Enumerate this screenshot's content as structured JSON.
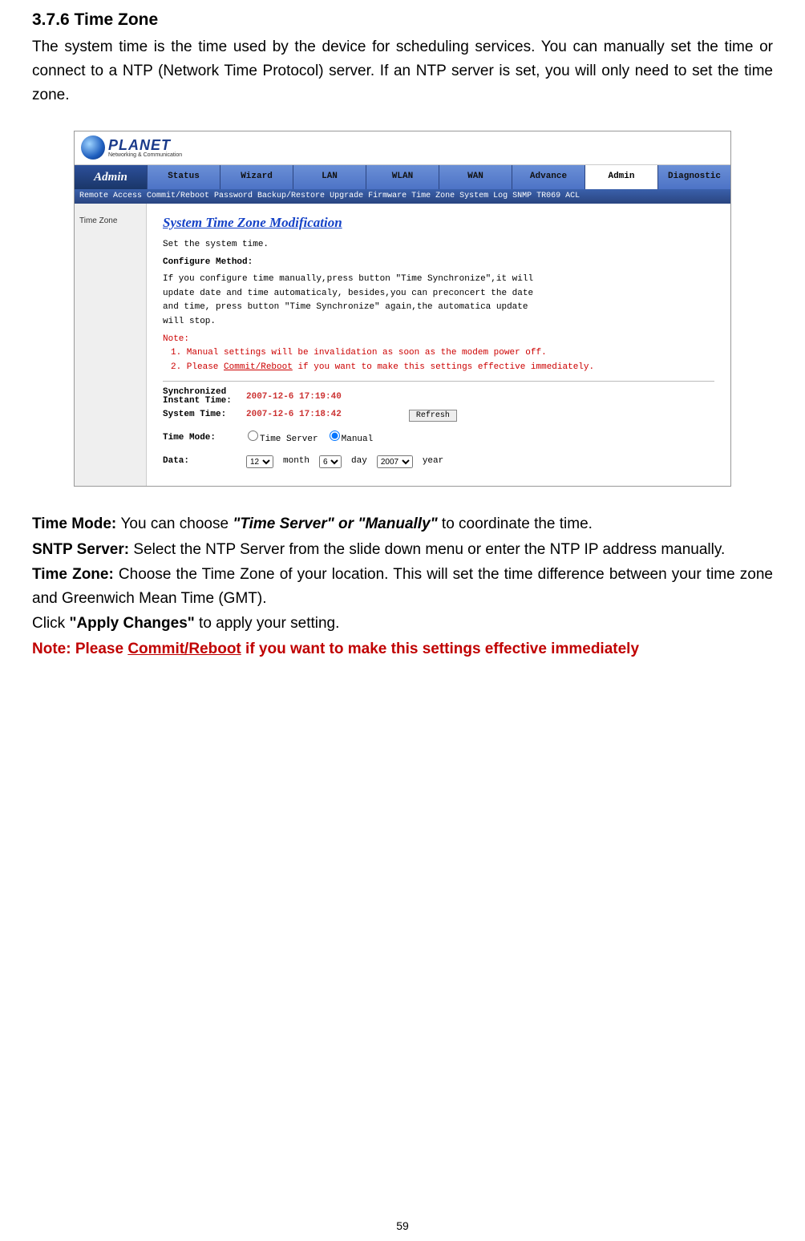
{
  "section": {
    "heading": "3.7.6 Time Zone",
    "intro": "The system time is the time used by the device for scheduling services. You can manually set the time or connect to a NTP (Network Time Protocol) server. If an NTP server is set, you will only need to set the time zone."
  },
  "router": {
    "logo": {
      "name": "PLANET",
      "tag": "Networking & Communication"
    },
    "active_section": "Admin",
    "nav": [
      "Status",
      "Wizard",
      "LAN",
      "WLAN",
      "WAN",
      "Advance",
      "Admin",
      "Diagnostic"
    ],
    "subnav": [
      "Remote Access",
      "Commit/Reboot",
      "Password",
      "Backup/Restore",
      "Upgrade Firmware",
      "Time Zone",
      "System Log",
      "SNMP",
      "TR069",
      "ACL"
    ],
    "left_label": "Time Zone",
    "panel_title": "System Time Zone Modification",
    "set_line": "Set the system time.",
    "cfg_heading": "Configure Method:",
    "cfg_body": "If you configure time manually,press button \"Time Synchronize\",it will update date and time automaticaly, besides,you can preconcert the date and time, press button \"Time Synchronize\" again,the automatica update will stop.",
    "note_label": "Note:",
    "note1": "1. Manual settings will be invalidation as soon as the modem power off.",
    "note2_a": "2. Please ",
    "note2_link": "Commit/Reboot",
    "note2_b": " if you want to make this settings effective immediately.",
    "sync_label": "Synchronized Instant Time:",
    "sync_val": "2007-12-6 17:19:40",
    "systime_label": "System Time:",
    "systime_val": "2007-12-6 17:18:42",
    "refresh_btn": "Refresh",
    "timemode_label": "Time Mode:",
    "radio1": "Time Server",
    "radio2": "Manual",
    "data_label": "Data:",
    "month_val": "12",
    "month_lbl": "month",
    "day_val": "6",
    "day_lbl": "day",
    "year_val": "2007",
    "year_lbl": "year"
  },
  "desc": {
    "l1a": "Time Mode: ",
    "l1b": "You can choose ",
    "l1c": "\"Time Server\" or \"Manually\"",
    "l1d": " to coordinate the time.",
    "l2a": "SNTP Server: ",
    "l2b": "Select the NTP Server from the slide down menu or enter the NTP IP address manually.",
    "l3a": "Time Zone: ",
    "l3b": "Choose the Time Zone of your location. This will set the time difference between your time zone and Greenwich Mean Time (GMT).",
    "l4a": "Click ",
    "l4b": "\"Apply Changes\"",
    "l4c": " to apply your setting.",
    "note_a": "Note: Please ",
    "note_link": "Commit/Reboot",
    "note_b": " if you want to make this settings effective immediately"
  },
  "page_number": "59"
}
